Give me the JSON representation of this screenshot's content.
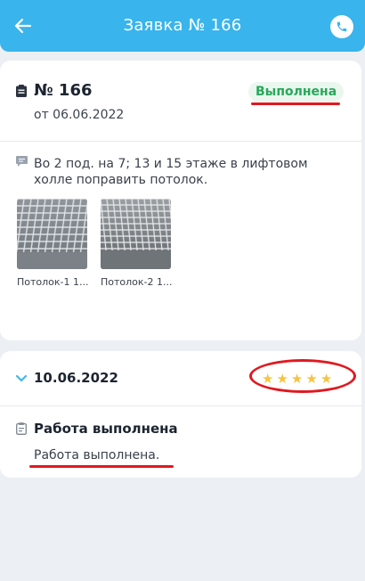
{
  "header": {
    "title": "Заявка № 166",
    "back_icon": "arrow-left-icon",
    "call_icon": "phone-icon"
  },
  "order": {
    "number": "№ 166",
    "date": "от 06.06.2022",
    "status": "Выполнена",
    "description": "Во 2 под. на 7;  13 и 15 этаже в лифтовом холле поправить потолок.",
    "photos": [
      {
        "caption": "Потолок-1 1..."
      },
      {
        "caption": "Потолок-2 1..."
      }
    ]
  },
  "response": {
    "date": "10.06.2022",
    "rating": 5,
    "work_title": "Работа выполнена",
    "work_text": "Работа выполнена."
  },
  "colors": {
    "header_bg": "#39b4ec",
    "status_green": "#27a85a",
    "star": "#f6c442",
    "annotation_red": "#e0191f"
  }
}
